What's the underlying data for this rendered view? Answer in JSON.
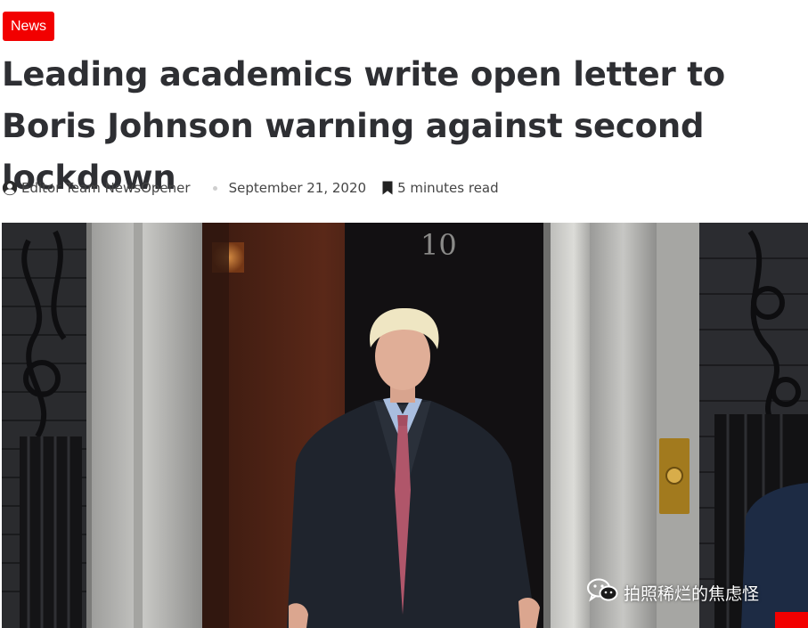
{
  "article": {
    "category": "News",
    "title": "Leading academics write open letter to Boris Johnson warning against second lockdown",
    "author": "Editor Team NewsOpener",
    "date": "September 21, 2020",
    "read_time": "5 minutes read",
    "door_number": "10"
  },
  "icons": {
    "author": "user-circle-icon",
    "read_time": "bookmark-icon",
    "watermark": "wechat-icon"
  },
  "watermark": {
    "text": "拍照稀烂的焦虑怪"
  },
  "colors": {
    "accent": "#f20000",
    "title": "#2e2f33",
    "meta_text": "#454545"
  }
}
